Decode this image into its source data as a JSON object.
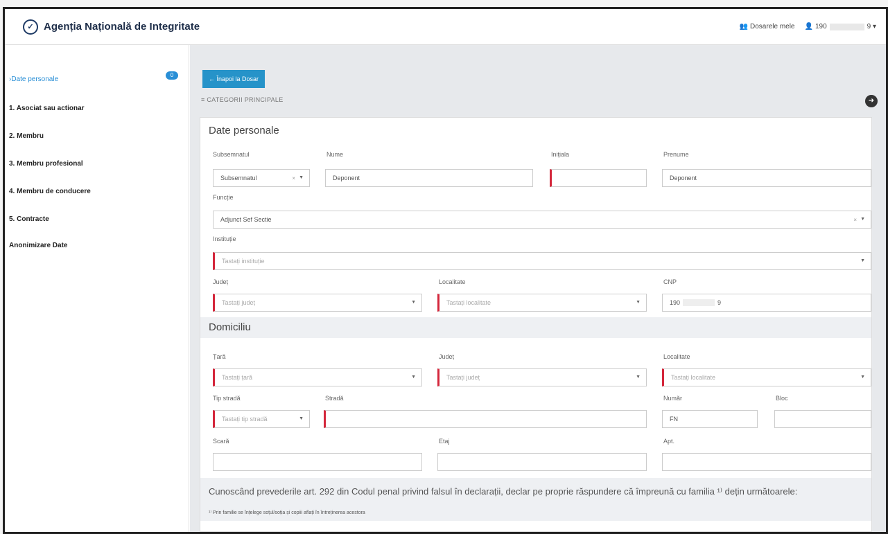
{
  "header": {
    "logo_text": "Agenția Națională de Integritate",
    "dosare_label": "Dosarele mele",
    "user_prefix": "190",
    "user_suffix": "9 ▾"
  },
  "sidebar": {
    "items": [
      {
        "label": "›Date personale",
        "badge": "0"
      },
      {
        "label": "1. Asociat sau actionar"
      },
      {
        "label": "2. Membru"
      },
      {
        "label": "3. Membru profesional"
      },
      {
        "label": "4. Membru de conducere"
      },
      {
        "label": "5. Contracte"
      },
      {
        "label": "Anonimizare Date"
      }
    ]
  },
  "main": {
    "back_label": "← Înapoi la Dosar",
    "category_label": "≡ CATEGORII PRINCIPALE",
    "panel_title": "Date personale",
    "fields": {
      "subsemnatul": {
        "label": "Subsemnatul",
        "value": "Subsemnatul"
      },
      "nume": {
        "label": "Nume",
        "value": "Deponent"
      },
      "initiala": {
        "label": "Inițiala",
        "value": ""
      },
      "prenume": {
        "label": "Prenume",
        "value": "Deponent"
      },
      "functie": {
        "label": "Funcție",
        "value": "Adjunct Sef Sectie"
      },
      "institutie": {
        "label": "Instituție",
        "placeholder": "Tastați instituție"
      },
      "judet": {
        "label": "Județ",
        "placeholder": "Tastați județ"
      },
      "localitate": {
        "label": "Localitate",
        "placeholder": "Tastați localitate"
      },
      "cnp": {
        "label": "CNP",
        "value_prefix": "190",
        "value_suffix": "9"
      }
    },
    "domiciliu": {
      "title": "Domiciliu",
      "tara": {
        "label": "Țară",
        "placeholder": "Tastați țară"
      },
      "judet": {
        "label": "Județ",
        "placeholder": "Tastați județ"
      },
      "localitate": {
        "label": "Localitate",
        "placeholder": "Tastați localitate"
      },
      "tip_strada": {
        "label": "Tip stradă",
        "placeholder": "Tastați tip stradă"
      },
      "strada": {
        "label": "Stradă",
        "value": ""
      },
      "numar": {
        "label": "Număr",
        "value": "FN"
      },
      "bloc": {
        "label": "Bloc",
        "value": ""
      },
      "scara": {
        "label": "Scară",
        "value": ""
      },
      "etaj": {
        "label": "Etaj",
        "value": ""
      },
      "apt": {
        "label": "Apt.",
        "value": ""
      }
    },
    "declaration": "Cunoscând prevederile art. 292 din Codul penal privind falsul în declarații, declar pe proprie răspundere că împreună cu familia ¹⁾ dețin următoarele:",
    "footnote": "¹⁾ Prin familie se înțelege soțul/soția și copiii aflați în întreținerea acestora"
  }
}
